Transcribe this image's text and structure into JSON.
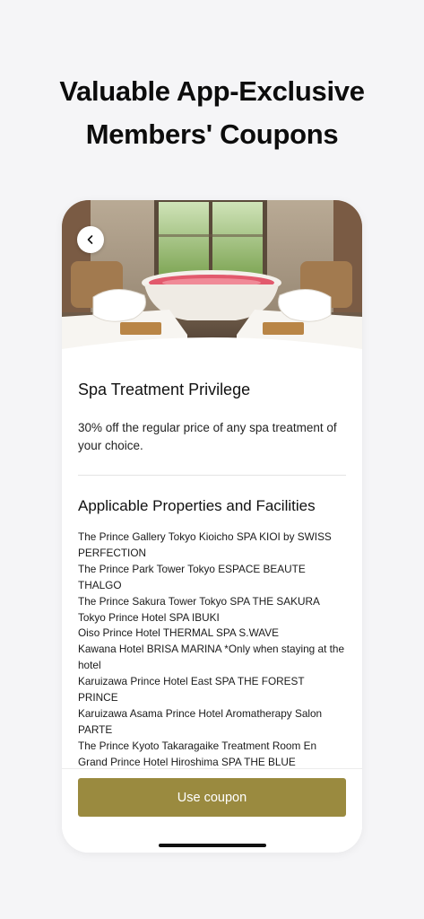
{
  "headline": {
    "line1": "Valuable App-Exclusive",
    "line2": "Members' Coupons"
  },
  "coupon": {
    "title": "Spa Treatment Privilege",
    "description": "30% off the regular price of any spa treatment of your choice.",
    "section_title": "Applicable Properties and Facilities",
    "properties": [
      "The Prince Gallery Tokyo Kioicho SPA KIOI by SWISS PERFECTION",
      "The Prince Park Tower Tokyo ESPACE BEAUTE THALGO",
      "The Prince Sakura Tower Tokyo SPA THE SAKURA",
      "Tokyo Prince Hotel SPA IBUKI",
      "Oiso Prince Hotel THERMAL SPA S.WAVE",
      "Kawana Hotel BRISA MARINA *Only when staying at the hotel",
      "Karuizawa Prince Hotel East SPA THE FOREST PRINCE",
      "Karuizawa Asama Prince Hotel Aromatherapy Salon PARTE",
      "The Prince Kyoto Takaragaike Treatment Room En",
      "Grand Prince Hotel Hiroshima SPA THE BLUE"
    ],
    "button_label": "Use coupon"
  },
  "icons": {
    "back": "chevron-left-icon"
  },
  "colors": {
    "button": "#9a8a3f",
    "background": "#f5f5f7"
  }
}
